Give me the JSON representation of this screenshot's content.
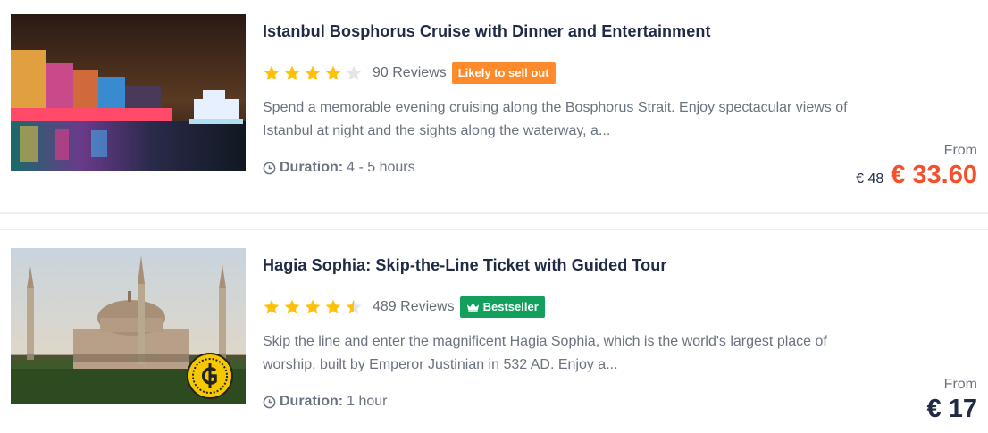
{
  "listings": [
    {
      "title": "Istanbul Bosphorus Cruise with Dinner and Entertainment",
      "rating": 4,
      "reviews": "90 Reviews",
      "badge": "Likely to sell out",
      "description_line1": "Spend a memorable evening cruising along the Bosphorus Strait. Enjoy spectacular views of",
      "description_line2": "Istanbul at night and the sights along the waterway, a...",
      "duration_label": "Duration:",
      "duration_value": "4 - 5 hours",
      "from_label": "From",
      "old_price": "€ 48",
      "price": "€ 33.60"
    },
    {
      "title": "Hagia Sophia: Skip-the-Line Ticket with Guided Tour",
      "rating": 4.5,
      "reviews": "489 Reviews",
      "badge": "Bestseller",
      "description_line1": "Skip the line and enter the magnificent Hagia Sophia, which is the world's largest place of",
      "description_line2": "worship, built by Emperor Justinian in 532 AD. Enjoy a...",
      "duration_label": "Duration:",
      "duration_value": "1 hour",
      "from_label": "From",
      "price": "€ 17"
    }
  ],
  "colors": {
    "star": "#ffc107",
    "sale_price": "#f4502e",
    "likely_badge": "#ff8a2b",
    "bestseller_badge": "#12a05c"
  },
  "icons": [
    "star-icon",
    "clock-icon",
    "crown-icon",
    "guide-coin-icon"
  ]
}
